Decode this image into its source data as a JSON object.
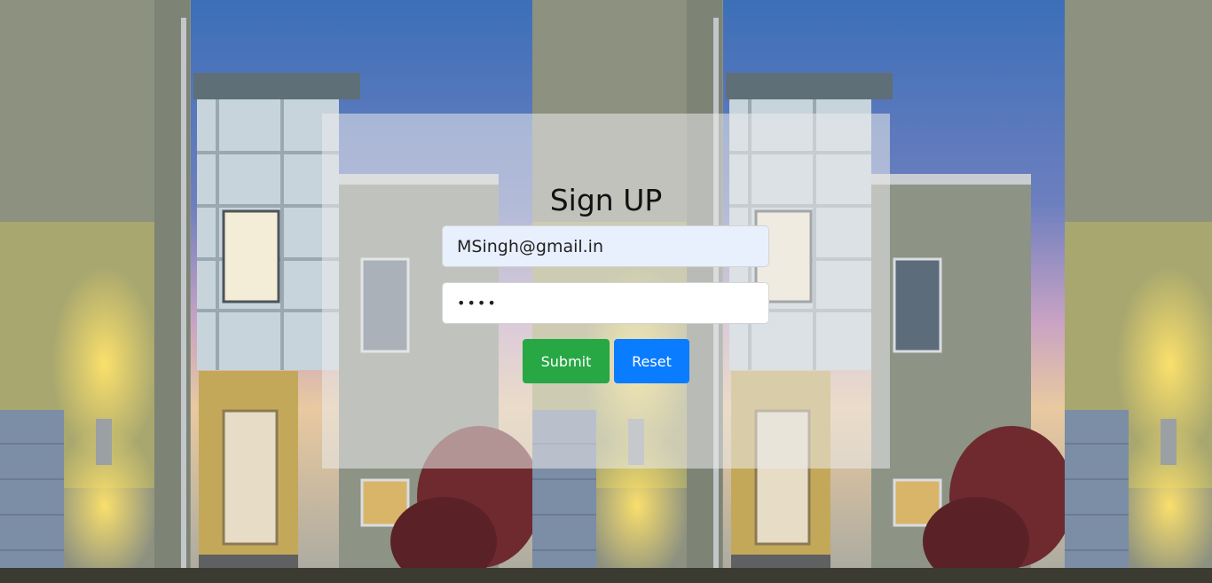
{
  "form": {
    "title": "Sign UP",
    "email_value": "MSingh@gmail.in",
    "password_value": "••••",
    "submit_label": "Submit",
    "reset_label": "Reset"
  },
  "colors": {
    "submit": "#28a745",
    "reset": "#0a7cff",
    "email_field_bg": "#e8f0fe"
  }
}
